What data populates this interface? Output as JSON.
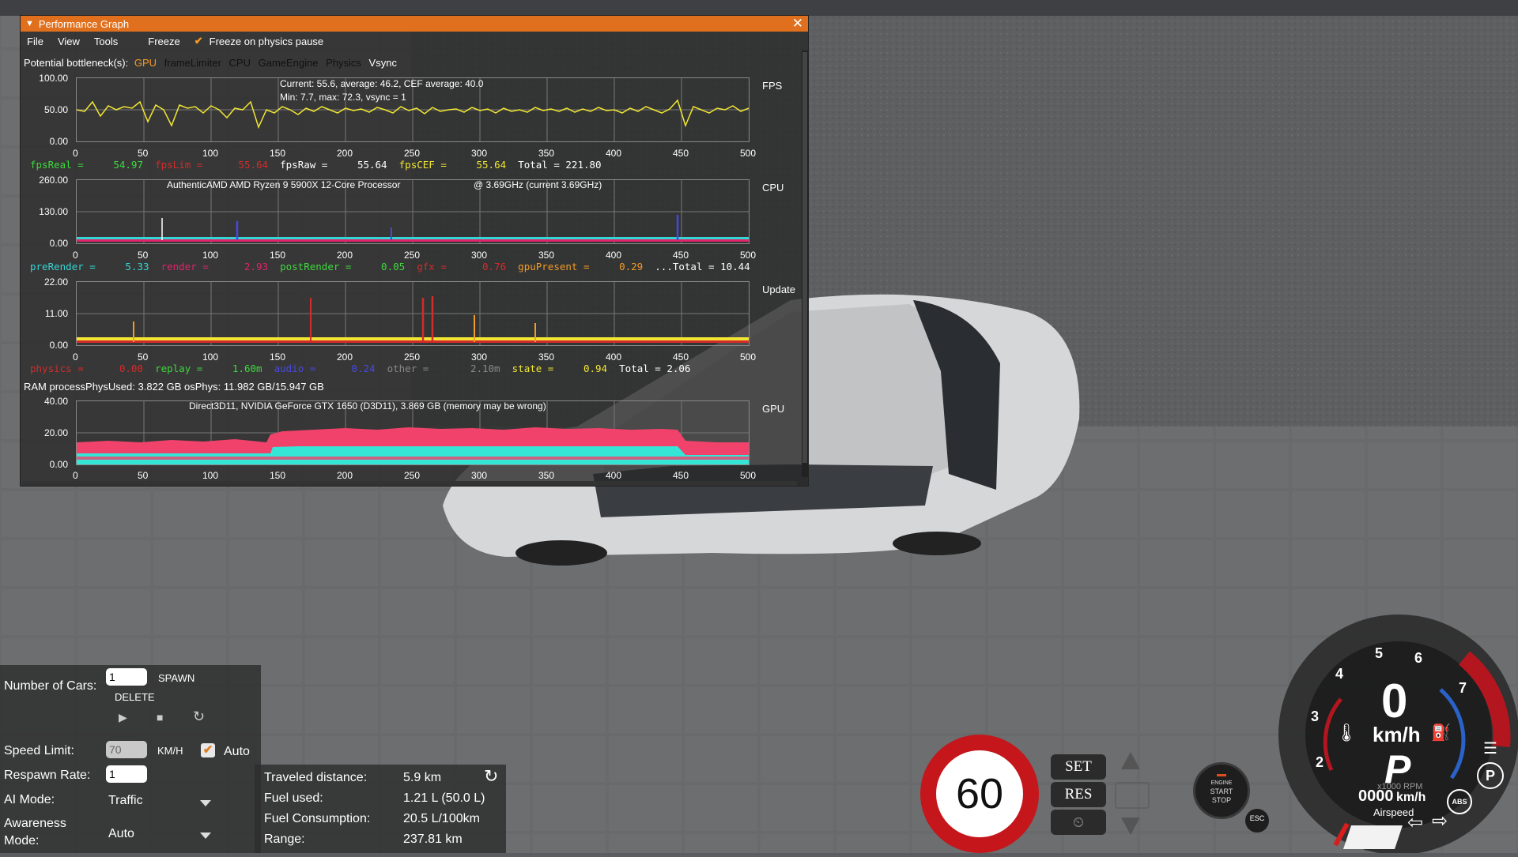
{
  "perf_window": {
    "title": "Performance Graph",
    "menu": [
      "File",
      "View",
      "Tools"
    ],
    "freeze_label": "Freeze",
    "freeze_on_pause_label": "Freeze on physics pause",
    "bottleneck_label": "Potential bottleneck(s):",
    "bottlenecks": [
      {
        "name": "GPU",
        "color": "#f39b25"
      },
      {
        "name": "frameLimiter",
        "color": "#111111"
      },
      {
        "name": "CPU",
        "color": "#111111"
      },
      {
        "name": "GameEngine",
        "color": "#111111"
      },
      {
        "name": "Physics",
        "color": "#111111"
      },
      {
        "name": "Vsync",
        "color": "#ffffff"
      }
    ],
    "x_ticks": [
      "0",
      "50",
      "100",
      "150",
      "200",
      "250",
      "300",
      "350",
      "400",
      "450",
      "500"
    ],
    "fps": {
      "label": "FPS",
      "y_ticks": [
        "100.00",
        "50.00",
        "0.00"
      ],
      "info1": "Current: 55.6, average: 46.2, CEF average: 40.0",
      "info2": "Min: 7.7, max: 72.3, vsync = 1",
      "legend": [
        {
          "text": "fpsReal =     54.97",
          "color": "#3ed93e"
        },
        {
          "text": "fpsLim =      55.64",
          "color": "#d42b2b"
        },
        {
          "text": "fpsRaw =     55.64",
          "color": "#ffffff"
        },
        {
          "text": "fpsCEF =     55.64",
          "color": "#f2e632"
        },
        {
          "text": "Total = 221.80",
          "color": "#ffffff"
        }
      ]
    },
    "cpu": {
      "label": "CPU",
      "y_ticks": [
        "260.00",
        "130.00",
        "0.00"
      ],
      "info1": "AuthenticAMD AMD Ryzen 9 5900X 12-Core Processor",
      "info2": "@ 3.69GHz (current 3.69GHz)",
      "legend": [
        {
          "text": "preRender =     5.33",
          "color": "#35d5d5"
        },
        {
          "text": "render =      2.93",
          "color": "#e0236a"
        },
        {
          "text": "postRender =     0.05",
          "color": "#3ed93e"
        },
        {
          "text": "gfx =      0.76",
          "color": "#d42b2b"
        },
        {
          "text": "gpuPresent =     0.29",
          "color": "#f39b25"
        },
        {
          "text": "...Total = 10.44",
          "color": "#ffffff"
        }
      ]
    },
    "update": {
      "label": "Update",
      "y_ticks": [
        "22.00",
        "11.00",
        "0.00"
      ],
      "legend": [
        {
          "text": "physics =      0.00",
          "color": "#d42b2b"
        },
        {
          "text": "replay =     1.60m",
          "color": "#3ed93e"
        },
        {
          "text": "audio =      0.24",
          "color": "#4848e0"
        },
        {
          "text": "other =       2.10m",
          "color": "#888888"
        },
        {
          "text": "state =     0.94",
          "color": "#f2e632"
        },
        {
          "text": "Total = 2.06",
          "color": "#ffffff"
        }
      ]
    },
    "ram_text": "RAM  processPhysUsed: 3.822 GB  osPhys: 11.982 GB/15.947 GB",
    "gpu": {
      "label": "GPU",
      "y_ticks": [
        "40.00",
        "20.00",
        "0.00"
      ],
      "info1": "Direct3D11, NVIDIA GeForce GTX 1650 (D3D11), 3.869 GB (memory may be wrong)"
    }
  },
  "traffic": {
    "num_cars_label": "Number of Cars:",
    "num_cars_value": "1",
    "spawn_label": "SPAWN",
    "delete_label": "DELETE",
    "speed_limit_label": "Speed Limit:",
    "speed_limit_value": "70",
    "speed_unit": "KM/H",
    "auto_label": "Auto",
    "respawn_label": "Respawn Rate:",
    "respawn_value": "1",
    "ai_mode_label": "AI Mode:",
    "ai_mode_value": "Traffic",
    "awareness_label_1": "Awareness",
    "awareness_label_2": "Mode:",
    "awareness_value": "Auto"
  },
  "trip": {
    "rows": [
      {
        "k": "Traveled distance:",
        "v": "5.9 km"
      },
      {
        "k": "Fuel used:",
        "v": "1.21 L (50.0 L)"
      },
      {
        "k": "Fuel Consumption:",
        "v": "20.5 L/100km"
      },
      {
        "k": "Range:",
        "v": "237.81 km"
      }
    ]
  },
  "hud": {
    "speed_limit_sign": "60",
    "set_label": "SET",
    "res_label": "RES",
    "engine_1": "ENGINE",
    "engine_2": "START",
    "engine_3": "STOP",
    "esc_label": "ESC",
    "gauge_numbers": [
      "2",
      "3",
      "4",
      "5",
      "6",
      "7"
    ],
    "speed_big": "0",
    "speed_unit": "km/h",
    "gear": "P",
    "rpm_label": "x1000 RPM",
    "odometer": "0000",
    "odometer_unit": "km/h",
    "airspeed_label": "Airspeed",
    "abs_label": "ABS",
    "park_label": "P"
  }
}
